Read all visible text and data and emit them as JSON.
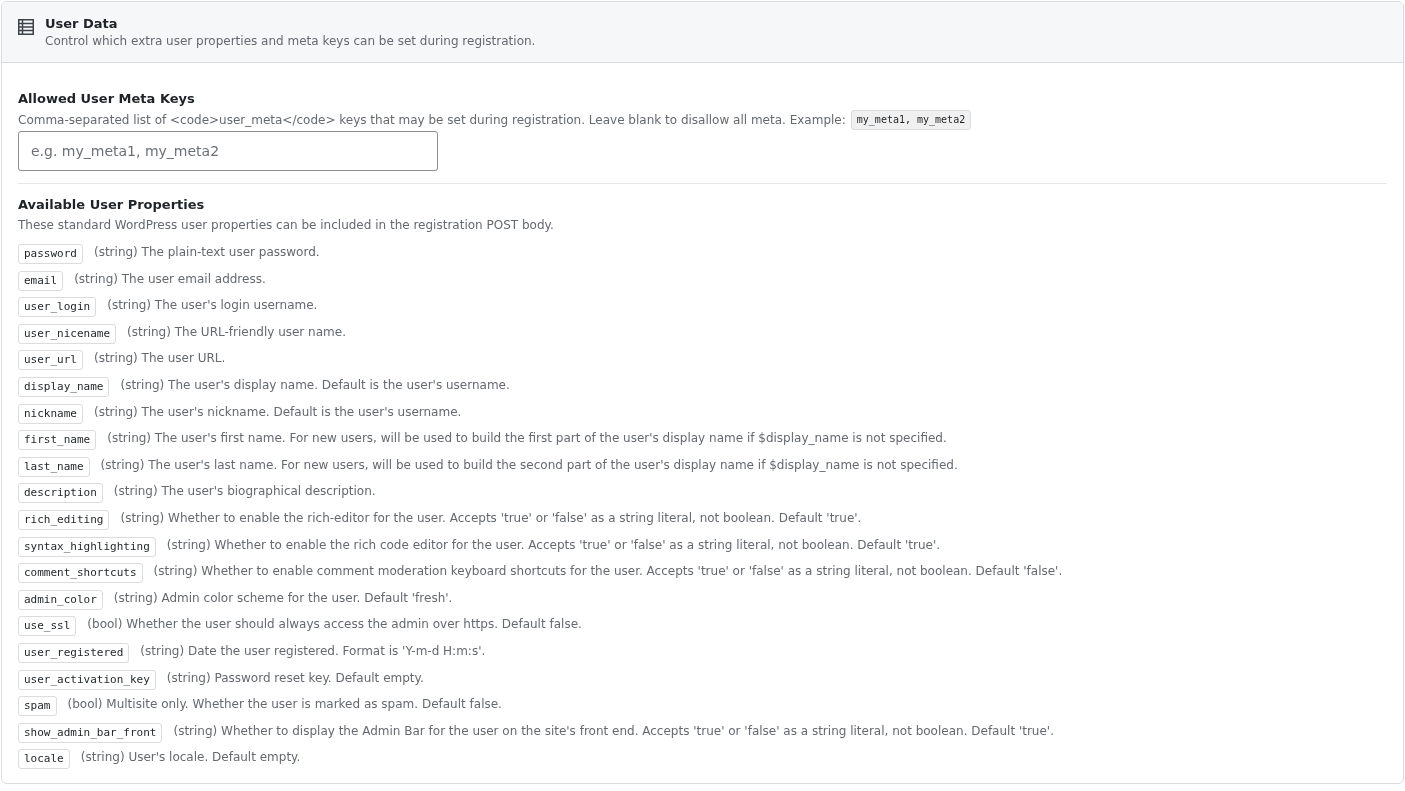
{
  "panel": {
    "title": "User Data",
    "subtitle": "Control which extra user properties and meta keys can be set during registration."
  },
  "meta_keys": {
    "label": "Allowed User Meta Keys",
    "description": "Comma-separated list of <code>user_meta</code> keys that may be set during registration. Leave blank to disallow all meta. Example:",
    "example": "my_meta1, my_meta2",
    "placeholder": "e.g. my_meta1, my_meta2"
  },
  "properties": {
    "title": "Available User Properties",
    "description": "These standard WordPress user properties can be included in the registration POST body.",
    "items": [
      {
        "key": "password",
        "description": "(string) The plain-text user password."
      },
      {
        "key": "email",
        "description": "(string) The user email address."
      },
      {
        "key": "user_login",
        "description": "(string) The user's login username."
      },
      {
        "key": "user_nicename",
        "description": "(string) The URL-friendly user name."
      },
      {
        "key": "user_url",
        "description": "(string) The user URL."
      },
      {
        "key": "display_name",
        "description": "(string) The user's display name. Default is the user's username."
      },
      {
        "key": "nickname",
        "description": "(string) The user's nickname. Default is the user's username."
      },
      {
        "key": "first_name",
        "description": "(string) The user's first name. For new users, will be used to build the first part of the user's display name if $display_name is not specified."
      },
      {
        "key": "last_name",
        "description": "(string) The user's last name. For new users, will be used to build the second part of the user's display name if $display_name is not specified."
      },
      {
        "key": "description",
        "description": "(string) The user's biographical description."
      },
      {
        "key": "rich_editing",
        "description": "(string) Whether to enable the rich-editor for the user. Accepts 'true' or 'false' as a string literal, not boolean. Default 'true'."
      },
      {
        "key": "syntax_highlighting",
        "description": "(string) Whether to enable the rich code editor for the user. Accepts 'true' or 'false' as a string literal, not boolean. Default 'true'."
      },
      {
        "key": "comment_shortcuts",
        "description": "(string) Whether to enable comment moderation keyboard shortcuts for the user. Accepts 'true' or 'false' as a string literal, not boolean. Default 'false'."
      },
      {
        "key": "admin_color",
        "description": "(string) Admin color scheme for the user. Default 'fresh'."
      },
      {
        "key": "use_ssl",
        "description": "(bool) Whether the user should always access the admin over https. Default false."
      },
      {
        "key": "user_registered",
        "description": "(string) Date the user registered. Format is 'Y-m-d H:m:s'."
      },
      {
        "key": "user_activation_key",
        "description": "(string) Password reset key. Default empty."
      },
      {
        "key": "spam",
        "description": "(bool) Multisite only. Whether the user is marked as spam. Default false."
      },
      {
        "key": "show_admin_bar_front",
        "description": "(string) Whether to display the Admin Bar for the user on the site's front end. Accepts 'true' or 'false' as a string literal, not boolean. Default 'true'."
      },
      {
        "key": "locale",
        "description": "(string) User's locale. Default empty."
      }
    ]
  }
}
